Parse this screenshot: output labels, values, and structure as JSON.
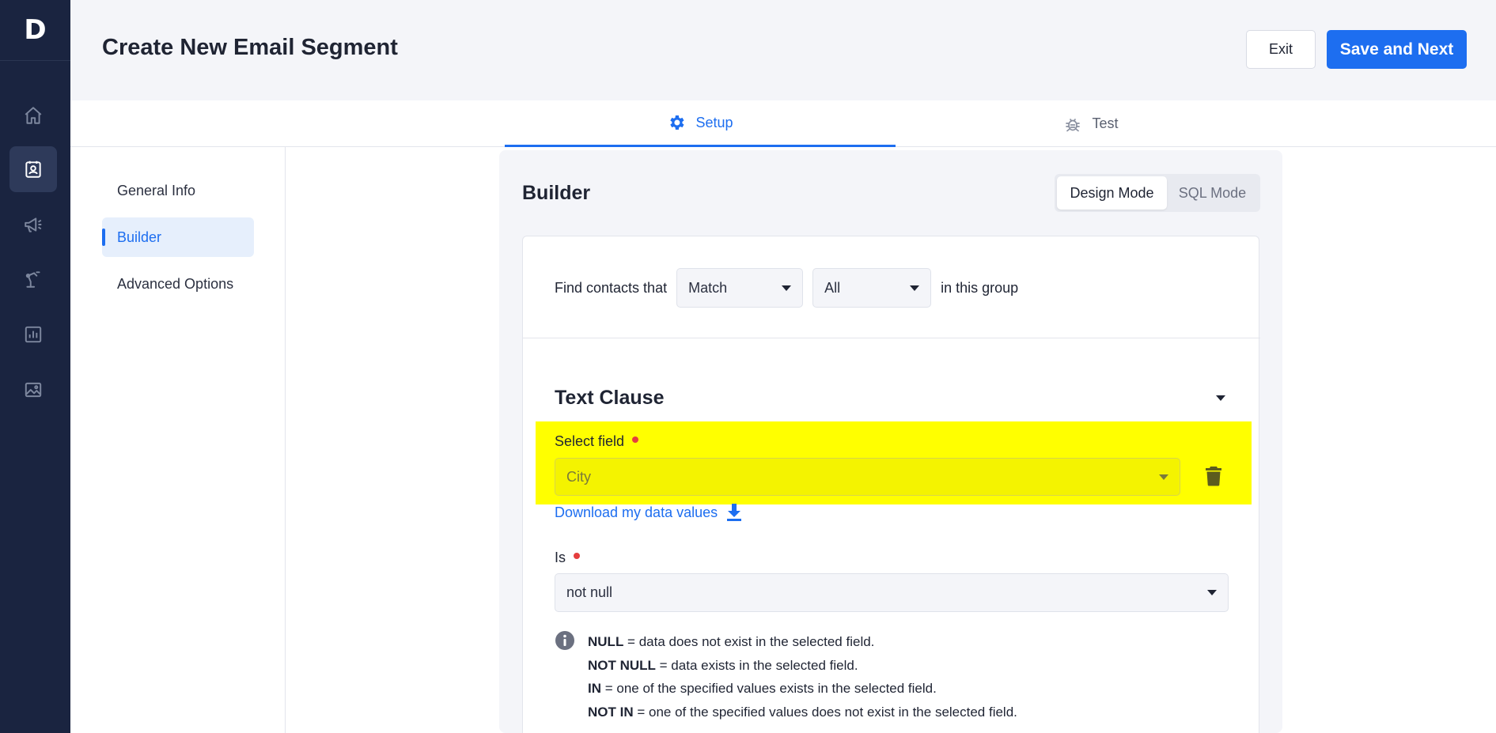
{
  "rail": {
    "logo": "D",
    "items": [
      {
        "icon": "home-icon"
      },
      {
        "icon": "contacts-icon",
        "active": true
      },
      {
        "icon": "megaphone-icon"
      },
      {
        "icon": "robot-arm-icon"
      },
      {
        "icon": "bar-chart-icon"
      },
      {
        "icon": "image-icon"
      }
    ]
  },
  "header": {
    "title": "Create New Email Segment",
    "exit_label": "Exit",
    "save_label": "Save and Next"
  },
  "tabs": {
    "setup": "Setup",
    "test": "Test",
    "active": "setup"
  },
  "nav": {
    "items": [
      {
        "label": "General Info"
      },
      {
        "label": "Builder",
        "active": true
      },
      {
        "label": "Advanced Options"
      }
    ]
  },
  "builder": {
    "title": "Builder",
    "modes": {
      "design": "Design Mode",
      "sql": "SQL Mode",
      "active": "design"
    },
    "find": {
      "prefix": "Find contacts that",
      "match_value": "Match",
      "scope_value": "All",
      "suffix": "in this group"
    },
    "clause": {
      "title": "Text Clause",
      "field_label": "Select field",
      "field_value": "City",
      "download_label": "Download my data values",
      "is_label": "Is",
      "is_value": "not null"
    },
    "info": [
      {
        "term": "NULL",
        "text": " = data does not exist in the selected field."
      },
      {
        "term": "NOT NULL",
        "text": " = data exists in the selected field."
      },
      {
        "term": "IN",
        "text": " = one of the specified values exists in the selected field."
      },
      {
        "term": "NOT IN",
        "text": " = one of the specified values does not exist in the selected field."
      }
    ]
  },
  "colors": {
    "accent": "#1d6ef0",
    "rail": "#1a2440",
    "highlight": "#ffff00",
    "required": "#e53e3e"
  }
}
